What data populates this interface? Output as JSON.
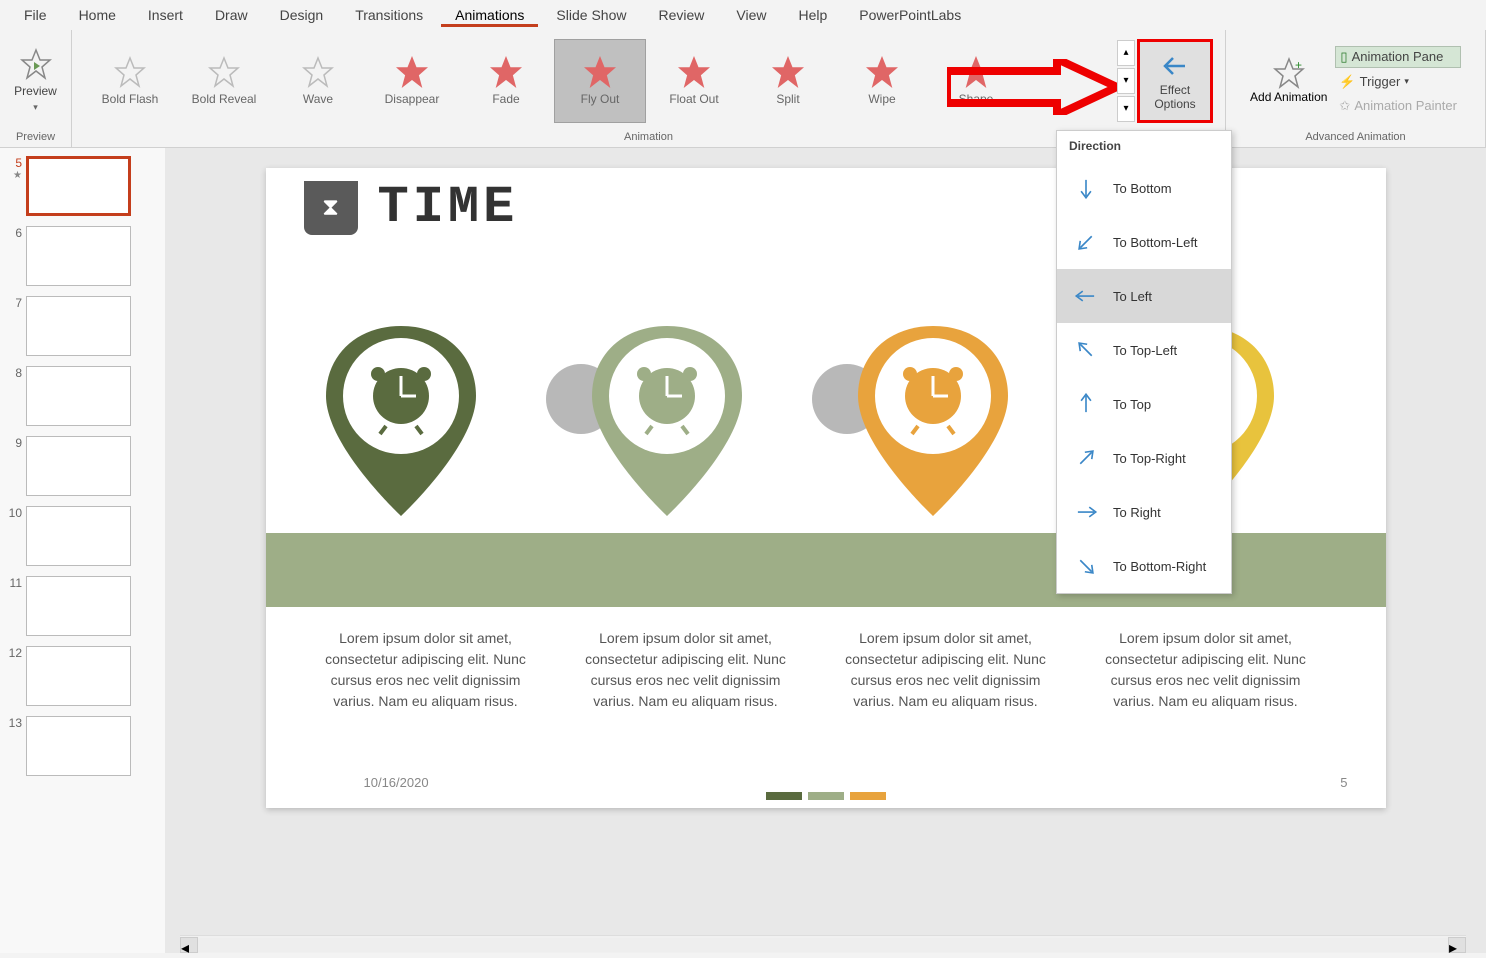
{
  "menu": [
    "File",
    "Home",
    "Insert",
    "Draw",
    "Design",
    "Transitions",
    "Animations",
    "Slide Show",
    "Review",
    "View",
    "Help",
    "PowerPointLabs"
  ],
  "active_menu": "Animations",
  "ribbon": {
    "preview": {
      "label": "Preview",
      "group": "Preview"
    },
    "animation_group": "Animation",
    "animations": [
      {
        "label": "Bold Flash",
        "color": "#bbb",
        "sel": false
      },
      {
        "label": "Bold Reveal",
        "color": "#bbb",
        "sel": false
      },
      {
        "label": "Wave",
        "color": "#bbb",
        "sel": false
      },
      {
        "label": "Disappear",
        "color": "#e06666",
        "sel": false
      },
      {
        "label": "Fade",
        "color": "#e06666",
        "sel": false
      },
      {
        "label": "Fly Out",
        "color": "#e06666",
        "sel": true
      },
      {
        "label": "Float Out",
        "color": "#e06666",
        "sel": false
      },
      {
        "label": "Split",
        "color": "#e06666",
        "sel": false
      },
      {
        "label": "Wipe",
        "color": "#e06666",
        "sel": false
      },
      {
        "label": "Shape",
        "color": "#e06666",
        "sel": false
      }
    ],
    "effect_options": "Effect Options",
    "add_animation": "Add Animation",
    "advanced_group": "Advanced Animation",
    "anim_pane": "Animation Pane",
    "trigger": "Trigger",
    "painter": "Animation Painter"
  },
  "thumbs": [
    {
      "n": "5",
      "active": true
    },
    {
      "n": "6"
    },
    {
      "n": "7"
    },
    {
      "n": "8"
    },
    {
      "n": "9"
    },
    {
      "n": "10"
    },
    {
      "n": "11"
    },
    {
      "n": "12"
    },
    {
      "n": "13"
    }
  ],
  "slide": {
    "title": "TIME",
    "body": "Lorem ipsum dolor sit amet, consectetur adipiscing elit. Nunc cursus eros nec velit dignissim varius. Nam eu aliquam risus.",
    "date": "10/16/2020",
    "page": "5",
    "pins": [
      {
        "color": "#5a6b3f"
      },
      {
        "color": "#9eae87"
      },
      {
        "color": "#e8a33d"
      },
      {
        "color": "#e8c33d"
      }
    ]
  },
  "dropdown": {
    "header": "Direction",
    "items": [
      {
        "label": "To Bottom",
        "dx": 0,
        "dy": 1,
        "sel": false
      },
      {
        "label": "To Bottom-Left",
        "dx": -1,
        "dy": 1,
        "sel": false
      },
      {
        "label": "To Left",
        "dx": -1,
        "dy": 0,
        "sel": true
      },
      {
        "label": "To Top-Left",
        "dx": -1,
        "dy": -1,
        "sel": false
      },
      {
        "label": "To Top",
        "dx": 0,
        "dy": -1,
        "sel": false
      },
      {
        "label": "To Top-Right",
        "dx": 1,
        "dy": -1,
        "sel": false
      },
      {
        "label": "To Right",
        "dx": 1,
        "dy": 0,
        "sel": false
      },
      {
        "label": "To Bottom-Right",
        "dx": 1,
        "dy": 1,
        "sel": false
      }
    ]
  }
}
